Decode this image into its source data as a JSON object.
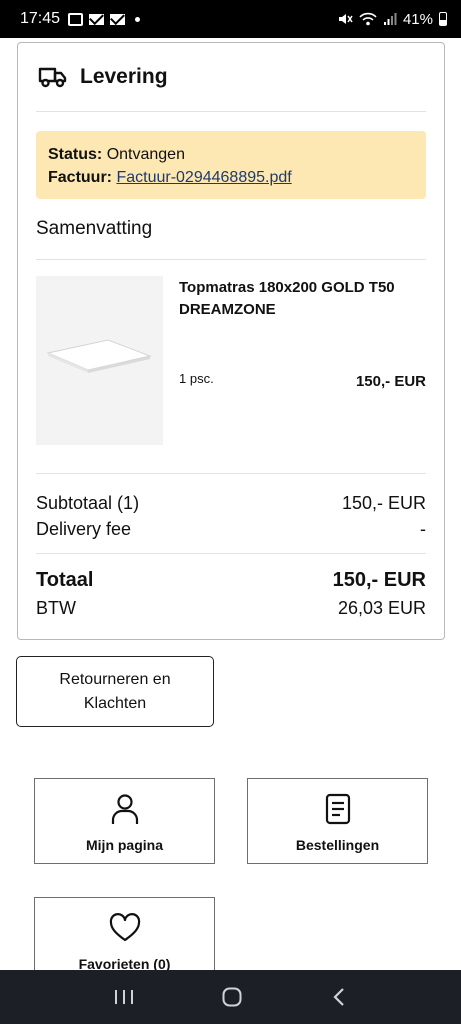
{
  "status_bar": {
    "time": "17:45",
    "battery": "41%",
    "battery_level": 0.41,
    "icons": [
      "call-icon",
      "mail-icon",
      "mail-icon",
      "dot-icon",
      "mute-icon",
      "wifi-icon",
      "signal-icon",
      "battery-icon"
    ]
  },
  "delivery": {
    "icon": "truck-icon",
    "title": "Levering",
    "status_label": "Status:",
    "status_value": "Ontvangen",
    "invoice_label": "Factuur:",
    "invoice_link": "Factuur-0294468895.pdf",
    "highlight_color": "#fde8b3"
  },
  "summary": {
    "title": "Samenvatting",
    "product": {
      "name": "Topmatras 180x200 GOLD T50 DREAMZONE",
      "quantity": "1 psc.",
      "price": "150,- EUR"
    },
    "subtotal_label": "Subtotaal (1)",
    "subtotal_value": "150,- EUR",
    "delivery_fee_label": "Delivery fee",
    "delivery_fee_value": "-",
    "total_label": "Totaal",
    "total_value": "150,- EUR",
    "vat_label": "BTW",
    "vat_value": "26,03 EUR"
  },
  "actions": {
    "returns_button": "Retourneren en Klachten"
  },
  "tiles": [
    {
      "label": "Mijn pagina",
      "icon": "user-icon"
    },
    {
      "label": "Bestellingen",
      "icon": "document-icon"
    },
    {
      "label": "Favorieten (0)",
      "icon": "heart-icon"
    }
  ],
  "navbar": {
    "icons": [
      "recent-apps-icon",
      "home-icon",
      "back-icon"
    ]
  }
}
